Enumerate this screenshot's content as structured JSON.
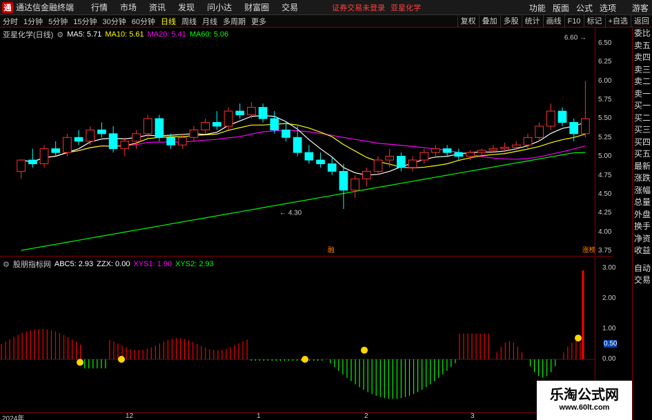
{
  "app": {
    "name": "通达信金融终端",
    "menu": [
      "行情",
      "市场",
      "资讯",
      "发现",
      "问小达",
      "财富圈",
      "交易"
    ],
    "warning": "证券交易未登录",
    "stock_title": "亚星化学",
    "right_menu": [
      "功能",
      "版面",
      "公式",
      "选项"
    ],
    "guest": "游客"
  },
  "toolbar": {
    "periods": [
      "分时",
      "1分钟",
      "5分钟",
      "15分钟",
      "30分钟",
      "60分钟",
      "日线",
      "周线",
      "月线",
      "多周期",
      "更多"
    ],
    "active_period": "日线",
    "tools": [
      "复权",
      "叠加",
      "多股",
      "统计",
      "画线",
      "F10",
      "标记",
      "+自选",
      "返回"
    ]
  },
  "main_legend": {
    "title": "亚星化学(日线)",
    "ma5": "MA5: 5.71",
    "ma10": "MA10: 5.61",
    "ma20": "MA20: 5.41",
    "ma60": "MA60: 5.06"
  },
  "price_axis": [
    "6.50",
    "6.25",
    "6.00",
    "5.75",
    "5.50",
    "5.25",
    "5.00",
    "4.75",
    "4.50",
    "4.25",
    "4.00",
    "3.75"
  ],
  "annotations": {
    "high": "6.60",
    "low": "4.30",
    "event1": "融",
    "event2": "涨榜"
  },
  "side_panel": [
    "委比",
    "卖五",
    "卖四",
    "卖三",
    "卖二",
    "卖一",
    "买一",
    "买二",
    "买三",
    "买四",
    "买五",
    "最新",
    "涨跌",
    "涨幅",
    "总量",
    "外盘",
    "换手",
    "净资",
    "收益",
    "自动",
    "交易"
  ],
  "ind_legend": {
    "title": "股朋指标网",
    "abc5": "ABC5: 2.93",
    "zzx": "ZZX: 0.00",
    "xys1": "XYS1: 1.90",
    "xys2": "XYS2: 2.93"
  },
  "ind_axis": [
    "3.00",
    "2.00",
    "1.00",
    "0.50",
    "0.00"
  ],
  "date_axis": [
    "2024年",
    "12",
    "1",
    "2",
    "3"
  ],
  "watermark": {
    "line1": "乐淘公式网",
    "line2": "www.60lt.com"
  },
  "colors": {
    "up": "#ff3232",
    "down": "#00ffff",
    "ma5": "#ffffff",
    "ma10": "#ffff00",
    "ma20": "#ff00ff",
    "ma60": "#00ff00",
    "ind_up": "#ff0000",
    "ind_down": "#00ff00"
  },
  "chart_data": {
    "type": "candlestick",
    "ylim": [
      3.75,
      6.6
    ],
    "candles": [
      [
        4.8,
        4.95,
        4.7,
        4.95
      ],
      [
        4.95,
        5.1,
        4.85,
        4.9
      ],
      [
        4.9,
        5.15,
        4.85,
        5.1
      ],
      [
        5.1,
        5.2,
        5.0,
        5.05
      ],
      [
        5.05,
        5.3,
        5.0,
        5.25
      ],
      [
        5.25,
        5.35,
        5.15,
        5.2
      ],
      [
        5.2,
        5.4,
        5.15,
        5.35
      ],
      [
        5.35,
        5.45,
        5.25,
        5.3
      ],
      [
        5.3,
        5.4,
        5.05,
        5.1
      ],
      [
        5.1,
        5.25,
        5.0,
        5.2
      ],
      [
        5.2,
        5.35,
        5.1,
        5.3
      ],
      [
        5.3,
        5.55,
        5.25,
        5.5
      ],
      [
        5.5,
        5.55,
        5.2,
        5.25
      ],
      [
        5.25,
        5.3,
        5.1,
        5.15
      ],
      [
        5.15,
        5.3,
        5.1,
        5.25
      ],
      [
        5.25,
        5.4,
        5.2,
        5.35
      ],
      [
        5.35,
        5.5,
        5.3,
        5.45
      ],
      [
        5.45,
        5.6,
        5.35,
        5.4
      ],
      [
        5.4,
        5.65,
        5.35,
        5.6
      ],
      [
        5.6,
        5.7,
        5.5,
        5.55
      ],
      [
        5.55,
        5.72,
        5.5,
        5.65
      ],
      [
        5.65,
        5.7,
        5.45,
        5.5
      ],
      [
        5.5,
        5.6,
        5.3,
        5.35
      ],
      [
        5.35,
        5.45,
        5.2,
        5.25
      ],
      [
        5.25,
        5.4,
        5.0,
        5.05
      ],
      [
        5.05,
        5.15,
        4.9,
        4.95
      ],
      [
        4.95,
        5.05,
        4.85,
        4.9
      ],
      [
        4.9,
        5.0,
        4.75,
        4.8
      ],
      [
        4.8,
        4.9,
        4.3,
        4.55
      ],
      [
        4.55,
        4.75,
        4.45,
        4.7
      ],
      [
        4.7,
        4.85,
        4.6,
        4.8
      ],
      [
        4.8,
        5.0,
        4.75,
        4.95
      ],
      [
        4.95,
        5.1,
        4.85,
        5.0
      ],
      [
        5.0,
        5.05,
        4.8,
        4.85
      ],
      [
        4.85,
        5.0,
        4.8,
        4.95
      ],
      [
        4.95,
        5.1,
        4.9,
        5.05
      ],
      [
        5.05,
        5.15,
        5.0,
        5.1
      ],
      [
        5.1,
        5.15,
        5.0,
        5.05
      ],
      [
        5.05,
        5.1,
        4.95,
        5.0
      ],
      [
        5.0,
        5.08,
        4.95,
        5.05
      ],
      [
        5.05,
        5.1,
        5.0,
        5.08
      ],
      [
        5.08,
        5.15,
        5.05,
        5.1
      ],
      [
        5.1,
        5.18,
        5.05,
        5.12
      ],
      [
        5.12,
        5.2,
        5.08,
        5.15
      ],
      [
        5.15,
        5.3,
        5.1,
        5.25
      ],
      [
        5.25,
        5.45,
        5.2,
        5.4
      ],
      [
        5.4,
        5.7,
        5.35,
        5.6
      ],
      [
        5.6,
        5.65,
        5.4,
        5.45
      ],
      [
        5.45,
        5.5,
        5.2,
        5.3
      ],
      [
        5.3,
        6.0,
        5.25,
        5.5
      ]
    ]
  }
}
